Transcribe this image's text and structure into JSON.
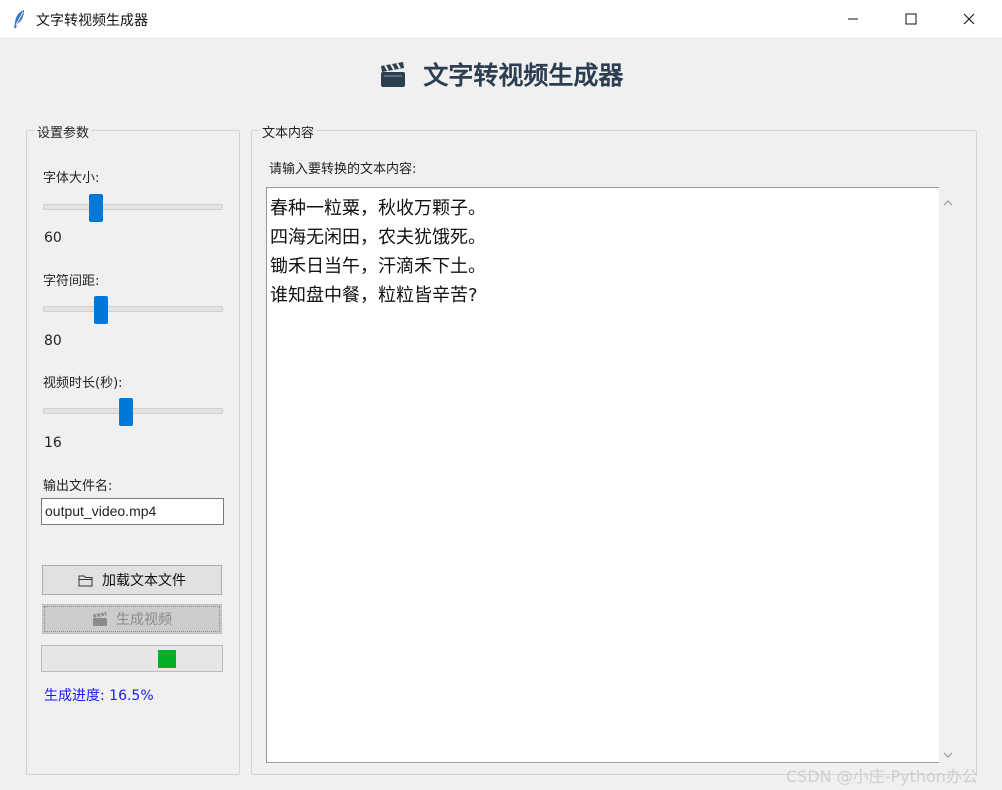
{
  "window": {
    "title": "文字转视频生成器",
    "icon": "feather-icon",
    "controls": [
      "minimize-icon",
      "maximize-icon",
      "close-icon"
    ]
  },
  "heading": {
    "icon": "clapperboard-icon",
    "text": "文字转视频生成器"
  },
  "settings": {
    "group_title": "设置参数",
    "font_size": {
      "label": "字体大小:",
      "value": "60",
      "fraction": 0.28
    },
    "char_spacing": {
      "label": "字符间距:",
      "value": "80",
      "fraction": 0.31
    },
    "duration": {
      "label": "视频时长(秒):",
      "value": "16",
      "fraction": 0.46
    },
    "output": {
      "label": "输出文件名:",
      "value": "output_video.mp4"
    },
    "load_button": {
      "icon": "folder-icon",
      "label": "加载文本文件"
    },
    "generate_button": {
      "icon": "clapperboard-icon",
      "label": "生成视频",
      "disabled": true
    },
    "progress": {
      "percent": 16.5,
      "text": "生成进度: 16.5%",
      "color": "#06b025"
    }
  },
  "text_content": {
    "group_title": "文本内容",
    "prompt": "请输入要转换的文本内容:",
    "lines": [
      "春种一粒粟，秋收万颗子。",
      "四海无闲田，农夫犹饿死。",
      "锄禾日当午，汗滴禾下土。",
      "谁知盘中餐，粒粒皆辛苦?"
    ]
  },
  "watermark": "CSDN @小庄-Python办公",
  "colors": {
    "accent": "#0078d7",
    "progress_text": "#1a1aff",
    "heading": "#2c3e50"
  }
}
